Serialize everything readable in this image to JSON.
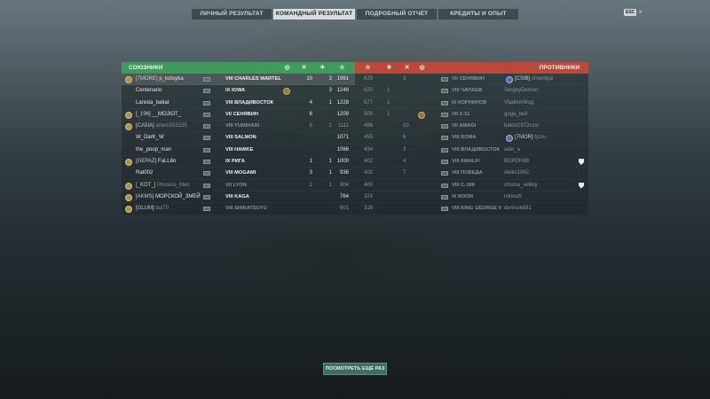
{
  "tabs": [
    {
      "label": "ЛИЧНЫЙ РЕЗУЛЬТАТ",
      "active": false
    },
    {
      "label": "КОМАНДНЫЙ РЕЗУЛЬТАТ",
      "active": true
    },
    {
      "label": "ПОДРОБНЫЙ ОТЧЁТ",
      "active": false
    },
    {
      "label": "КРЕДИТЫ И ОПЫТ",
      "active": false
    }
  ],
  "esc": {
    "key": "ESC",
    "close": "×"
  },
  "allies": {
    "title": "СОЮЗНИКИ",
    "header_icons": [
      "badge-icon",
      "kills-icon",
      "planes-icon",
      "star-icon"
    ],
    "rows": [
      {
        "clan": "[7MORE]",
        "name": "p_kotsyba",
        "tier": "VIII",
        "ship": "CHARLES MARTEL",
        "badge": false,
        "kills": "19",
        "planes": "3",
        "xp": "1961",
        "me": true,
        "dead": false
      },
      {
        "clan": "",
        "name": "Centenario",
        "tier": "IX",
        "ship": "IOWA",
        "badge": true,
        "kills": "",
        "planes": "3",
        "xp": "1248",
        "me": false,
        "dead": false
      },
      {
        "clan": "",
        "name": "Lanista_batiat",
        "tier": "VIII",
        "ship": "ВЛАДИВОСТОК",
        "badge": false,
        "kills": "4",
        "planes": "1",
        "xp": "1228",
        "me": false,
        "dead": false
      },
      {
        "clan": "[_196]",
        "name": "__MOJIOT_",
        "tier": "VII",
        "ship": "СЕНЯВИН",
        "badge": false,
        "kills": "6",
        "planes": "",
        "xp": "1209",
        "me": false,
        "dead": false
      },
      {
        "clan": "[CA5IA]",
        "name": "artem153155",
        "tier": "VIII",
        "ship": "YUMIHARI",
        "badge": false,
        "kills": "6",
        "planes": "1",
        "xp": "1111",
        "me": false,
        "dead": true
      },
      {
        "clan": "",
        "name": "W_DarK_W",
        "tier": "VIII",
        "ship": "SALMON",
        "badge": false,
        "kills": "",
        "planes": "",
        "xp": "1071",
        "me": false,
        "dead": false
      },
      {
        "clan": "",
        "name": "the_poop_man",
        "tier": "VIII",
        "ship": "HAWKE",
        "badge": false,
        "kills": "",
        "planes": "",
        "xp": "1066",
        "me": false,
        "dead": false
      },
      {
        "clan": "[GEPAZ]",
        "name": "FaLL6n",
        "tier": "IX",
        "ship": "РИГА",
        "badge": false,
        "kills": "1",
        "planes": "1",
        "xp": "1000",
        "me": false,
        "dead": false
      },
      {
        "clan": "",
        "name": "Rat002",
        "tier": "VIII",
        "ship": "MOGAMI",
        "badge": false,
        "kills": "3",
        "planes": "1",
        "xp": "936",
        "me": false,
        "dead": false
      },
      {
        "clan": "[_KOT_]",
        "name": "Process_Men",
        "tier": "VII",
        "ship": "LYON",
        "badge": false,
        "kills": "2",
        "planes": "1",
        "xp": "904",
        "me": false,
        "dead": true
      },
      {
        "clan": "[AKMS]",
        "name": "МОРСКОЙ_ЗМЕЙ",
        "tier": "VIII",
        "ship": "KAGA",
        "badge": false,
        "kills": "",
        "planes": "",
        "xp": "764",
        "me": false,
        "dead": false
      },
      {
        "clan": "[GLUM]",
        "name": "bul70",
        "tier": "VIII",
        "ship": "SHIRATSUYU",
        "badge": false,
        "kills": "",
        "planes": "",
        "xp": "601",
        "me": false,
        "dead": true
      }
    ]
  },
  "enemies": {
    "title": "ПРОТИВНИКИ",
    "header_icons": [
      "star-icon",
      "planes-icon",
      "kills-icon",
      "badge-icon"
    ],
    "rows": [
      {
        "xp": "629",
        "planes": "",
        "kills": "3",
        "badge": false,
        "tier": "VII",
        "ship": "СЕНЯВИН",
        "clan": "[CSIB]",
        "name": "smerdyai",
        "dead": true
      },
      {
        "xp": "620",
        "planes": "1",
        "kills": "",
        "badge": false,
        "tier": "VIII",
        "ship": "ЧАПАЕВ",
        "clan": "",
        "name": "SergeyDemon",
        "dead": true
      },
      {
        "xp": "577",
        "planes": "1",
        "kills": "",
        "badge": false,
        "tier": "IX",
        "ship": "КОРНИЛОВ",
        "clan": "",
        "name": "VladimirMog",
        "dead": true
      },
      {
        "xp": "509",
        "planes": "1",
        "kills": "",
        "badge": true,
        "tier": "VII",
        "ship": "Z-31",
        "clan": "",
        "name": "goga_bull",
        "dead": true
      },
      {
        "xp": "496",
        "planes": "",
        "kills": "10",
        "badge": false,
        "tier": "VII",
        "ship": "AMAGI",
        "clan": "",
        "name": "baton1972cssr",
        "dead": true
      },
      {
        "xp": "455",
        "planes": "",
        "kills": "6",
        "badge": false,
        "tier": "VIII",
        "ship": "ROMA",
        "clan": "[7MOR]",
        "name": "tyzru",
        "dead": true
      },
      {
        "xp": "434",
        "planes": "",
        "kills": "3",
        "badge": false,
        "tier": "VIII",
        "ship": "ВЛАДИВОСТОК",
        "clan": "",
        "name": "adel_a",
        "dead": true
      },
      {
        "xp": "402",
        "planes": "",
        "kills": "4",
        "badge": false,
        "tier": "VIII",
        "ship": "AMALFI",
        "clan": "",
        "name": "ВОРОН88",
        "dead": true,
        "shield": true
      },
      {
        "xp": "402",
        "planes": "",
        "kills": "7",
        "badge": false,
        "tier": "VIII",
        "ship": "ПОБЕДА",
        "clan": "",
        "name": "Aleks1962",
        "dead": true
      },
      {
        "xp": "400",
        "planes": "",
        "kills": "",
        "badge": false,
        "tier": "VIII",
        "ship": "C-189",
        "clan": "",
        "name": "chuma_velikiy",
        "dead": true,
        "shield": true
      },
      {
        "xp": "324",
        "planes": "",
        "kills": "",
        "badge": false,
        "tier": "IX",
        "ship": "ROON",
        "clan": "",
        "name": "niklow5",
        "dead": true
      },
      {
        "xp": "316",
        "planes": "",
        "kills": "",
        "badge": false,
        "tier": "VIII",
        "ship": "KING GEORGE V",
        "clan": "",
        "name": "denisok881",
        "dead": true
      }
    ]
  },
  "replay_button": "ПОСМОТРЕТЬ ЕЩЁ РАЗ"
}
